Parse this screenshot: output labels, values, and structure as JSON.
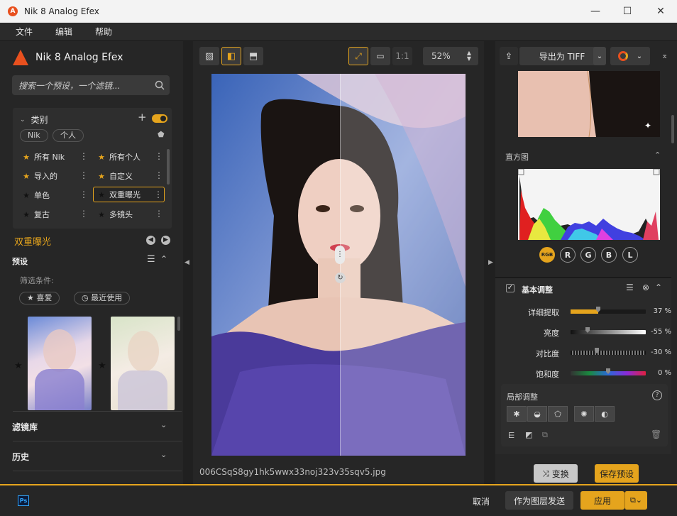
{
  "window": {
    "title": "Nik 8 Analog Efex",
    "minimize": "—",
    "maximize": "☐",
    "close": "✕"
  },
  "menu": [
    "文件",
    "编辑",
    "帮助"
  ],
  "brand": {
    "name": "Nik 8 Analog Efex"
  },
  "search": {
    "placeholder": "搜索一个预设，一个滤镜..."
  },
  "category": {
    "title": "类别",
    "chips": [
      "Nik",
      "个人"
    ],
    "items": [
      {
        "label": "所有 Nik",
        "star": "gold"
      },
      {
        "label": "所有个人",
        "star": "gold"
      },
      {
        "label": "导入的",
        "star": "gold"
      },
      {
        "label": "自定义",
        "star": "gold"
      },
      {
        "label": "单色",
        "star": "black"
      },
      {
        "label": "双重曝光",
        "star": "black",
        "selected": true
      },
      {
        "label": "复古",
        "star": "black"
      },
      {
        "label": "多镜头",
        "star": "black"
      }
    ]
  },
  "selected_category": "双重曝光",
  "presets": {
    "title": "预设",
    "filter_label": "筛选条件:",
    "favorite": "喜爱",
    "recent": "最近使用"
  },
  "sections": {
    "filters": "滤镜库",
    "history": "历史"
  },
  "center": {
    "zoom": "52%",
    "ratio": "1:1",
    "filename": "006CSqS8gy1hk5wwx33noj323v35sqv5.jpg"
  },
  "right": {
    "export": "导出为 TIFF",
    "histogram_title": "直方图",
    "channels": [
      "RGB",
      "R",
      "G",
      "B",
      "L"
    ],
    "basic_title": "基本调整",
    "sliders": [
      {
        "label": "详细提取",
        "value": "37 %",
        "fraction": 0.37
      },
      {
        "label": "亮度",
        "value": "-55 %",
        "fraction": 0.225
      },
      {
        "label": "对比度",
        "value": "-30 %",
        "fraction": 0.35
      },
      {
        "label": "饱和度",
        "value": "0 %",
        "fraction": 0.5
      }
    ],
    "local_title": "局部调整",
    "swap": "变换",
    "save_preset": "保存预设"
  },
  "bottom": {
    "cancel": "取消",
    "send_layer": "作为图层发送",
    "apply": "应用",
    "ps": "Ps"
  },
  "colors": {
    "accent": "#e5a41d",
    "brand": "#e8501e"
  }
}
